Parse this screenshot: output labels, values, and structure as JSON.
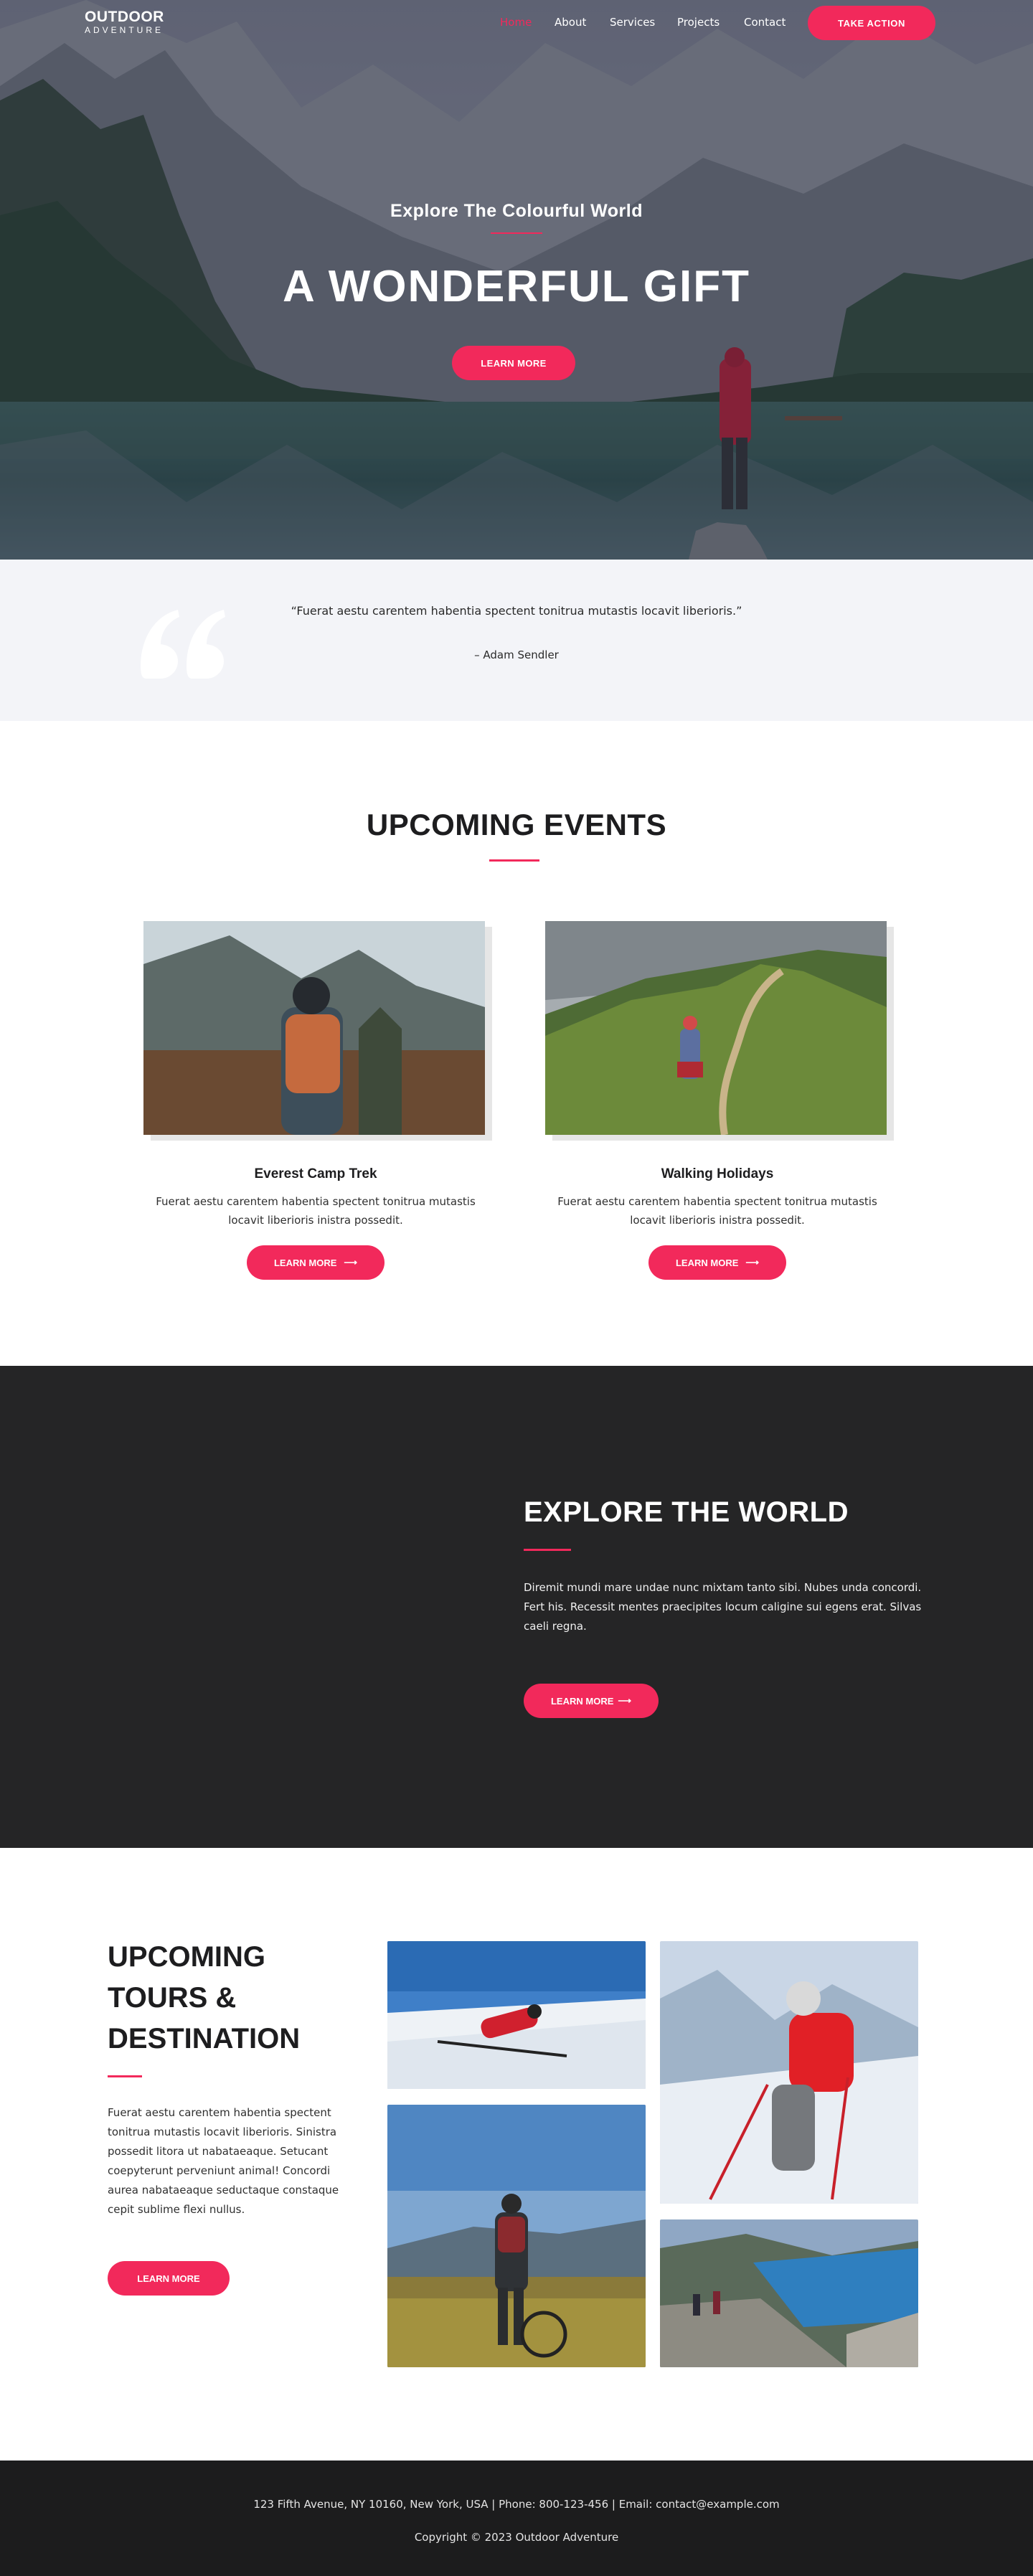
{
  "brand": {
    "line1": "OUTDOOR",
    "line2": "ADVENTURE"
  },
  "nav": {
    "items": [
      {
        "label": "Home",
        "active": true
      },
      {
        "label": "About"
      },
      {
        "label": "Services"
      },
      {
        "label": "Projects"
      },
      {
        "label": "Contact"
      }
    ],
    "cta_label": "TAKE ACTION"
  },
  "hero": {
    "subtitle": "Explore The Colourful World",
    "title": "A WONDERFUL GIFT",
    "button_label": "LEARN MORE"
  },
  "quote": {
    "text": "“Fuerat aestu carentem habentia spectent tonitrua mutastis locavit liberioris.”",
    "author": "– Adam Sendler"
  },
  "events": {
    "title": "UPCOMING EVENTS",
    "items": [
      {
        "title": "Everest Camp Trek",
        "text": "Fuerat aestu carentem habentia spectent tonitrua mutastis locavit liberioris inistra possedit.",
        "button_label": "LEARN MORE",
        "button_icon": "arrow-right-icon"
      },
      {
        "title": "Walking Holidays",
        "text": "Fuerat aestu carentem habentia spectent tonitrua mutastis locavit liberioris inistra possedit.",
        "button_label": "LEARN MORE",
        "button_icon": "arrow-right-icon"
      }
    ]
  },
  "explore": {
    "title": "EXPLORE THE WORLD",
    "text": "Diremit mundi mare undae nunc mixtam tanto sibi. Nubes unda concordi. Fert his. Recessit mentes praecipites locum caligine sui egens erat. Silvas caeli regna.",
    "button_label": "LEARN MORE",
    "button_icon": "arrow-right-icon"
  },
  "tours": {
    "title": "UPCOMING TOURS & DESTINATION",
    "text": "Fuerat aestu carentem habentia spectent tonitrua mutastis locavit liberioris. Sinistra possedit litora ut nabataeaque. Setucant coepyterunt perveniunt animal! Concordi aurea nabataeaque seductaque constaque cepit sublime flexi nullus.",
    "button_label": "LEARN MORE"
  },
  "footer": {
    "address": "123 Fifth Avenue, NY 10160, New York, USA | Phone: 800-123-456 | Email: contact@example.com",
    "copyright": "Copyright © 2023 Outdoor Adventure"
  },
  "colors": {
    "accent": "#f2295b",
    "dark_section": "#252526",
    "footer": "#1c1c1d",
    "quote_bg": "#f3f4f8"
  }
}
